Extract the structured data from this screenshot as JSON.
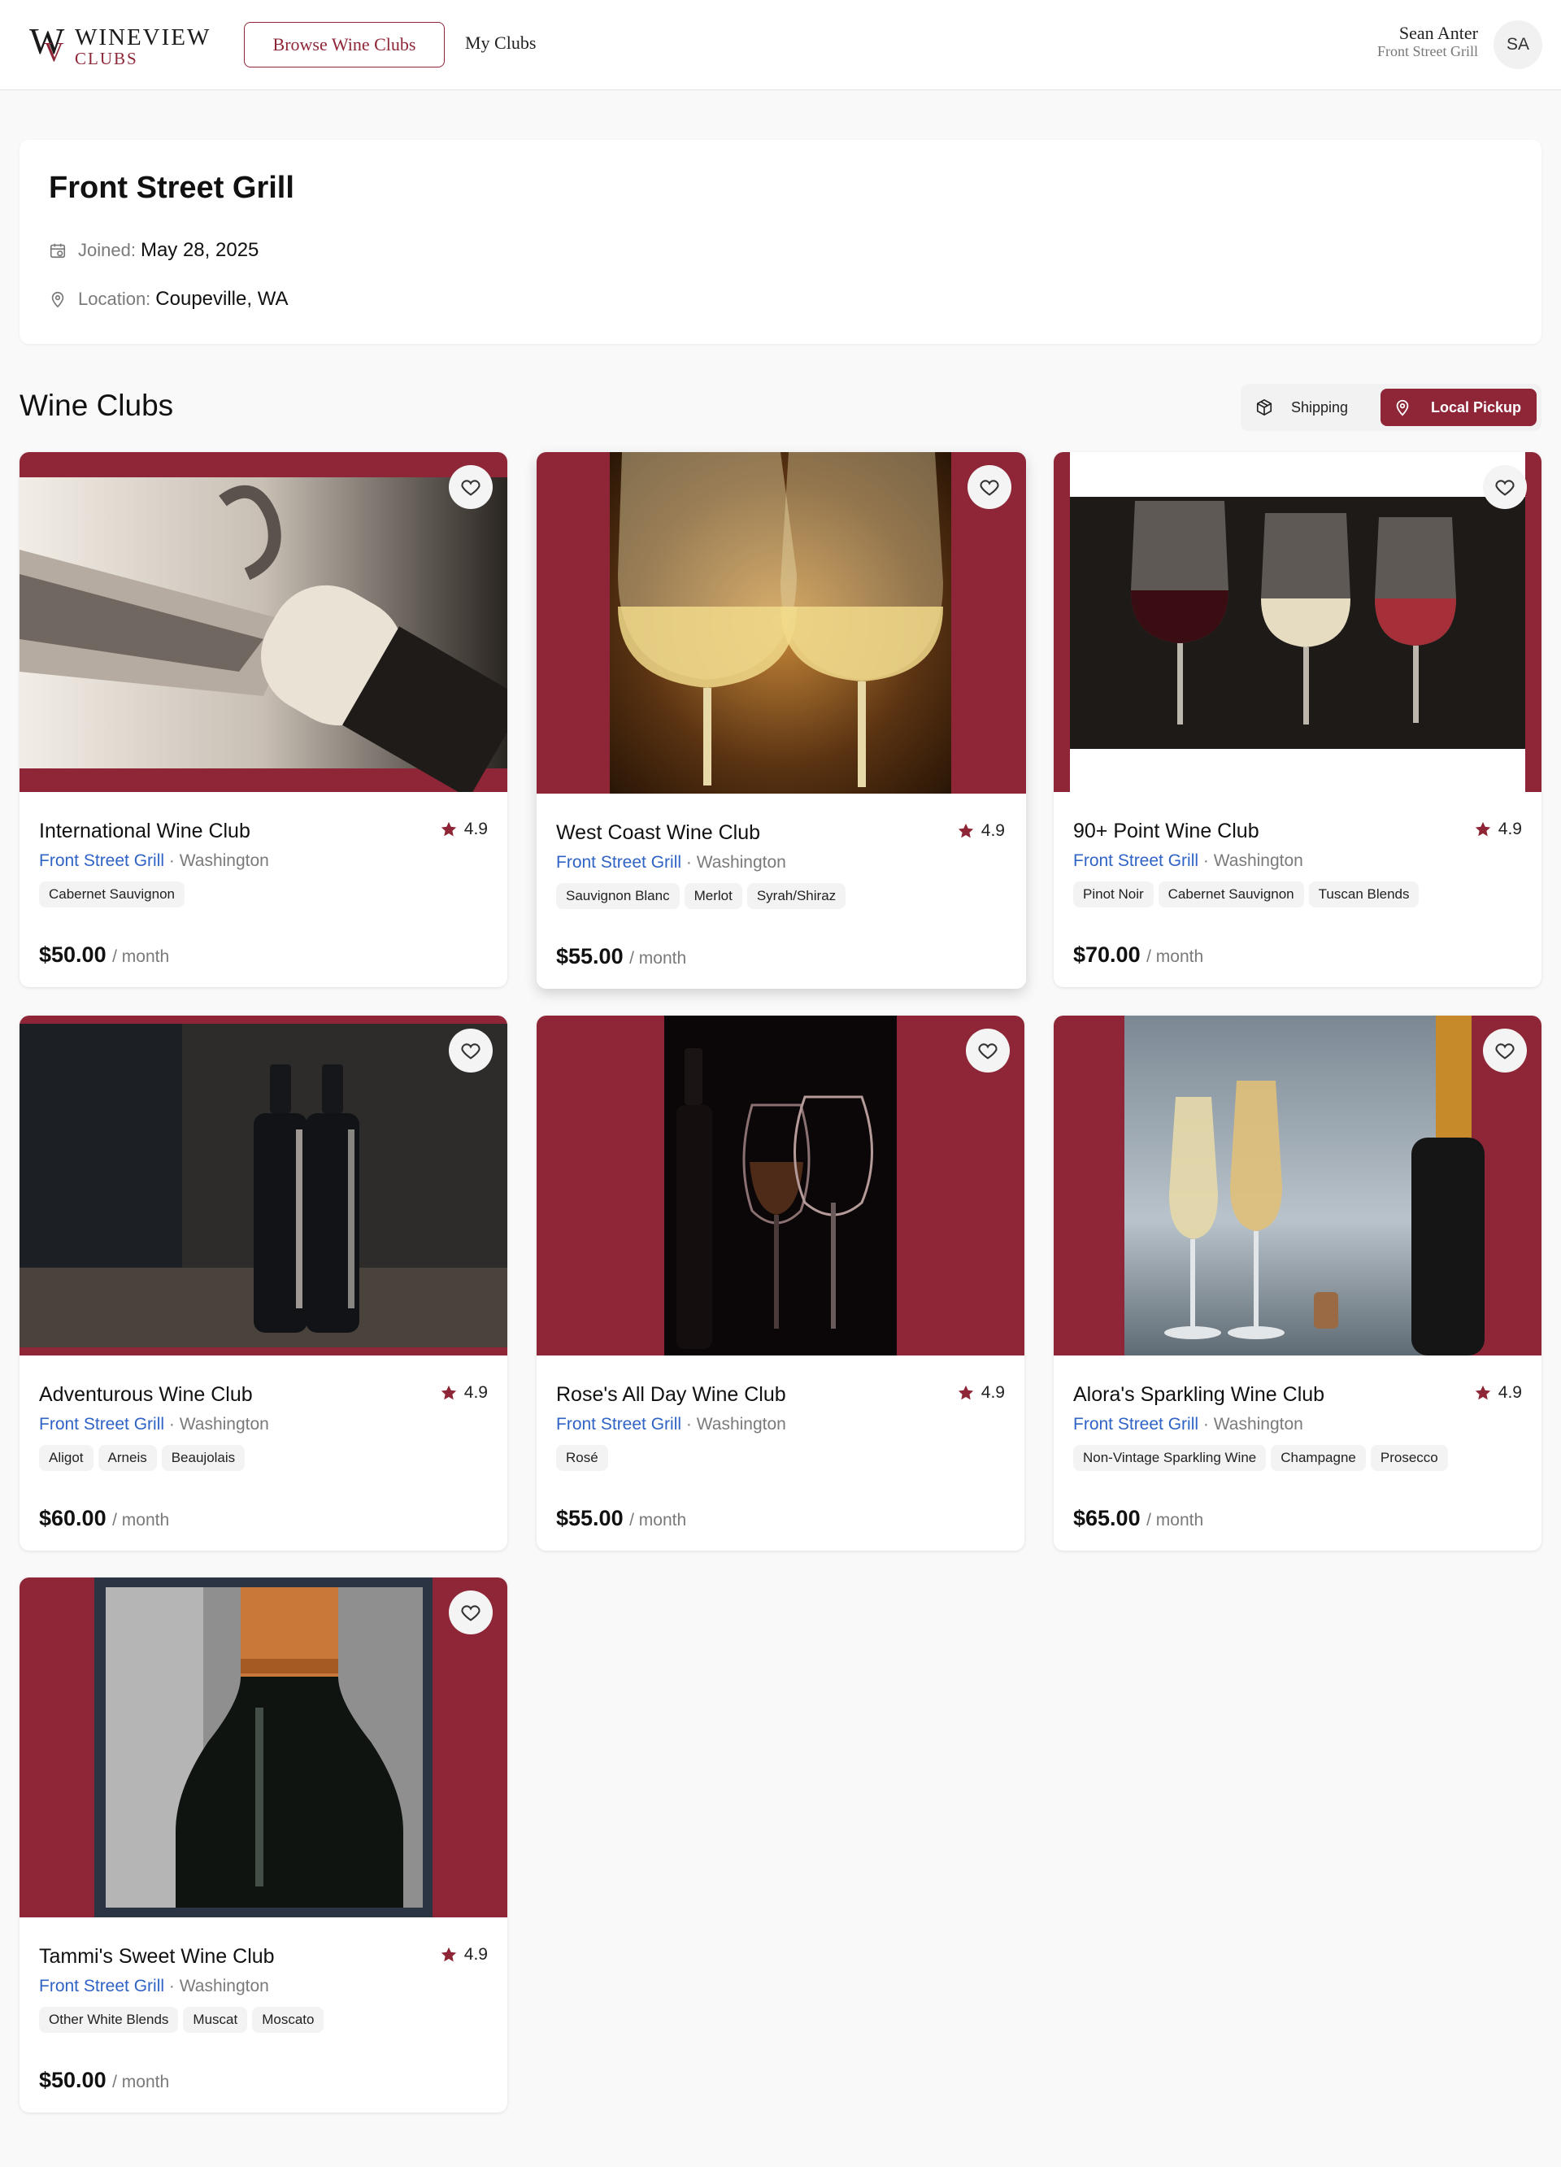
{
  "header": {
    "logo_title": "WINEVIEW",
    "logo_subtitle": "CLUBS",
    "logo_mark_w": "W",
    "logo_mark_v": "V",
    "nav_browse": "Browse Wine Clubs",
    "nav_my_clubs": "My Clubs",
    "user_name": "Sean Anter",
    "user_org": "Front Street Grill",
    "user_initials": "SA"
  },
  "profile": {
    "name": "Front Street Grill",
    "joined_label": "Joined:",
    "joined_value": "May 28, 2025",
    "location_label": "Location:",
    "location_value": "Coupeville, WA"
  },
  "section": {
    "title": "Wine Clubs",
    "shipping_label": "Shipping",
    "pickup_label": "Local Pickup",
    "active_filter": "Local Pickup"
  },
  "colors": {
    "brand": "#8e2637",
    "link": "#2f63c5"
  },
  "clubs": [
    {
      "title": "International Wine Club",
      "rating": "4.9",
      "venue": "Front Street Grill",
      "separator": "·",
      "region": "Washington",
      "tags": [
        "Cabernet Sauvignon"
      ],
      "price": "$50.00",
      "per": "/ month"
    },
    {
      "title": "West Coast Wine Club",
      "rating": "4.9",
      "venue": "Front Street Grill",
      "separator": "·",
      "region": "Washington",
      "tags": [
        "Sauvignon Blanc",
        "Merlot",
        "Syrah/Shiraz"
      ],
      "price": "$55.00",
      "per": "/ month"
    },
    {
      "title": "90+ Point Wine Club",
      "rating": "4.9",
      "venue": "Front Street Grill",
      "separator": "·",
      "region": "Washington",
      "tags": [
        "Pinot Noir",
        "Cabernet Sauvignon",
        "Tuscan Blends"
      ],
      "price": "$70.00",
      "per": "/ month"
    },
    {
      "title": "Adventurous Wine Club",
      "rating": "4.9",
      "venue": "Front Street Grill",
      "separator": "·",
      "region": "Washington",
      "tags": [
        "Aligot",
        "Arneis",
        "Beaujolais"
      ],
      "price": "$60.00",
      "per": "/ month"
    },
    {
      "title": "Rose's All Day Wine Club",
      "rating": "4.9",
      "venue": "Front Street Grill",
      "separator": "·",
      "region": "Washington",
      "tags": [
        "Rosé"
      ],
      "price": "$55.00",
      "per": "/ month"
    },
    {
      "title": "Alora's Sparkling Wine Club",
      "rating": "4.9",
      "venue": "Front Street Grill",
      "separator": "·",
      "region": "Washington",
      "tags": [
        "Non-Vintage Sparkling Wine",
        "Champagne",
        "Prosecco"
      ],
      "price": "$65.00",
      "per": "/ month"
    },
    {
      "title": "Tammi's Sweet Wine Club",
      "rating": "4.9",
      "venue": "Front Street Grill",
      "separator": "·",
      "region": "Washington",
      "tags": [
        "Other White Blends",
        "Muscat",
        "Moscato"
      ],
      "price": "$50.00",
      "per": "/ month"
    }
  ]
}
